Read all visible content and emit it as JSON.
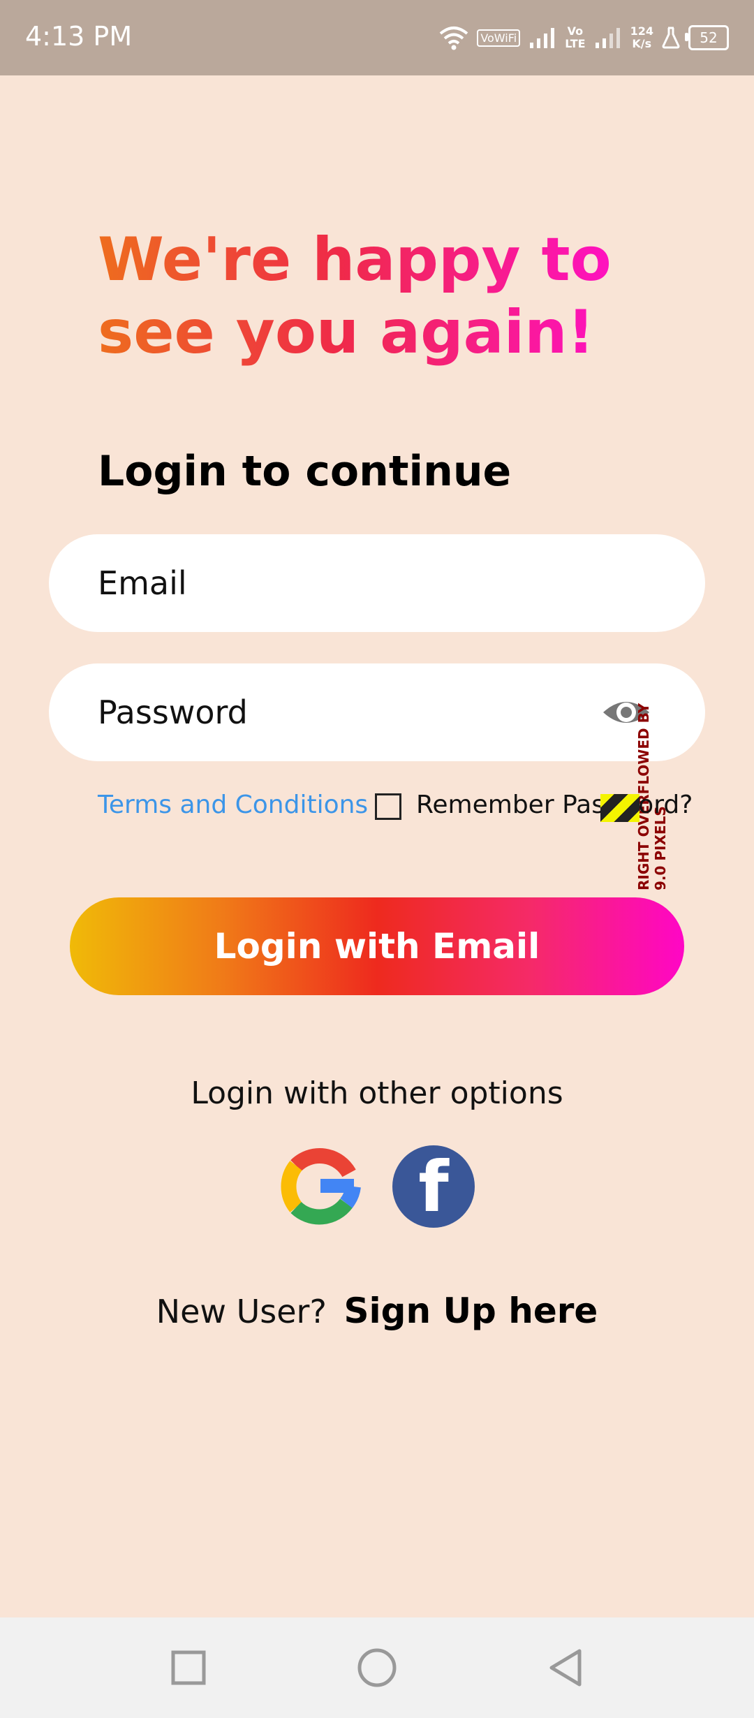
{
  "status_bar": {
    "time": "4:13 PM",
    "wifi_label": "VoWiFi",
    "volte_label_top": "Vo",
    "volte_label_bottom": "LTE",
    "speed_value": "124",
    "speed_unit": "K/s",
    "battery": "52"
  },
  "hero": {
    "line1": "We're happy to",
    "line2": "see you again!"
  },
  "subtitle": "Login to continue",
  "form": {
    "email_placeholder": "Email",
    "password_placeholder": "Password",
    "terms_link": "Terms and Conditions",
    "remember_label": "Remember Password?",
    "overflow_debug": "RIGHT OVERFLOWED BY 9.0 PIXELS"
  },
  "login_button": "Login with Email",
  "other_options": "Login with other options",
  "social": {
    "google_icon": "google-logo",
    "facebook_icon": "facebook-logo",
    "facebook_glyph": "f"
  },
  "signup": {
    "prompt": "New User?",
    "link": "Sign Up here"
  },
  "colors": {
    "background": "#f9e4d6",
    "status_bar": "#baa89b",
    "accent_blue": "#3c95e8",
    "facebook_blue": "#3a5798",
    "gradient_start": "#f0ba08",
    "gradient_mid": "#ee2a1e",
    "gradient_end": "#ff06c6"
  }
}
